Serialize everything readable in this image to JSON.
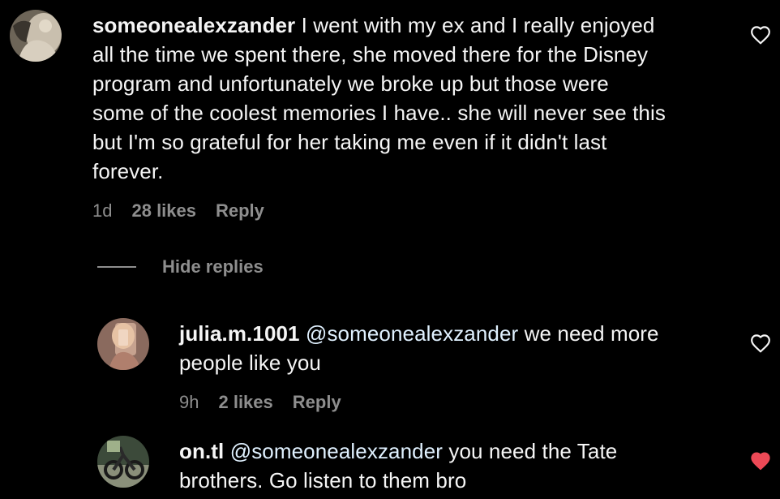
{
  "colors": {
    "background": "#000000",
    "text": "#f5f5f5",
    "meta": "#8e8e8e",
    "mention": "#e0f1ff",
    "liked_heart": "#ed4956"
  },
  "comments": [
    {
      "username": "someonealexzander",
      "lines": [
        " I went with my ex and I really enjoyed",
        "all the time we spent there, she moved there for the Disney",
        "program and unfortunately we broke up but those were",
        "some of the coolest memories I have.. she will never see this",
        "but I'm so grateful for her taking me even if it didn't last",
        "forever."
      ],
      "time": "1d",
      "likes": "28 likes",
      "reply_label": "Reply",
      "heart_icon": "heart-outline-icon",
      "liked": false
    }
  ],
  "hide_replies_label": "Hide replies",
  "replies": [
    {
      "username": "julia.m.1001",
      "mention": "@someonealexzander",
      "lines": [
        " we need more",
        "people like you"
      ],
      "time": "9h",
      "likes": "2 likes",
      "reply_label": "Reply",
      "heart_icon": "heart-outline-icon",
      "liked": false
    },
    {
      "username": "on.tl",
      "mention": "@someonealexzander",
      "lines": [
        " you need the Tate",
        "brothers. Go listen to them bro"
      ],
      "heart_icon": "heart-filled-icon",
      "liked": true
    }
  ]
}
